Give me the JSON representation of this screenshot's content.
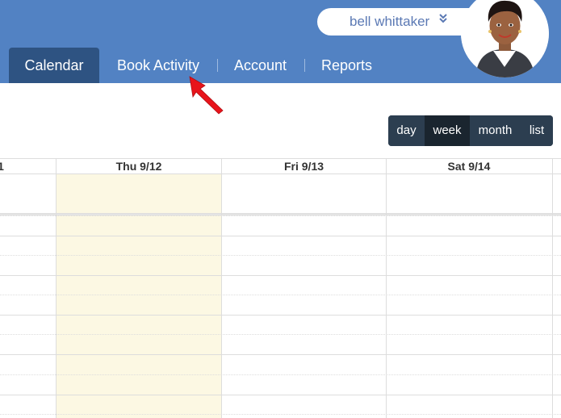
{
  "user": {
    "name": "bell whittaker",
    "chevron": "»"
  },
  "nav": {
    "tabs": [
      {
        "label": "Calendar",
        "active": true
      },
      {
        "label": "Book Activity",
        "active": false
      },
      {
        "label": "Account",
        "active": false
      },
      {
        "label": "Reports",
        "active": false
      }
    ]
  },
  "views": {
    "buttons": [
      {
        "label": "day",
        "active": false
      },
      {
        "label": "week",
        "active": true
      },
      {
        "label": "month",
        "active": false
      },
      {
        "label": "list",
        "active": false
      }
    ]
  },
  "calendar": {
    "partial_left_label": "1",
    "columns": [
      {
        "label": "Thu 9/12",
        "today": true
      },
      {
        "label": "Fri 9/13",
        "today": false
      },
      {
        "label": "Sat 9/14",
        "today": false
      }
    ]
  },
  "colors": {
    "header": "#5282c3",
    "active_tab": "#2e5382",
    "view_button": "#2c3e50",
    "view_button_active": "#1a252f",
    "today": "#fcf8e3",
    "annotation_arrow": "#e8141b"
  },
  "icons": {
    "user_menu": "double-chevron-down-icon",
    "annotation": "red-arrow-pointer-icon"
  }
}
